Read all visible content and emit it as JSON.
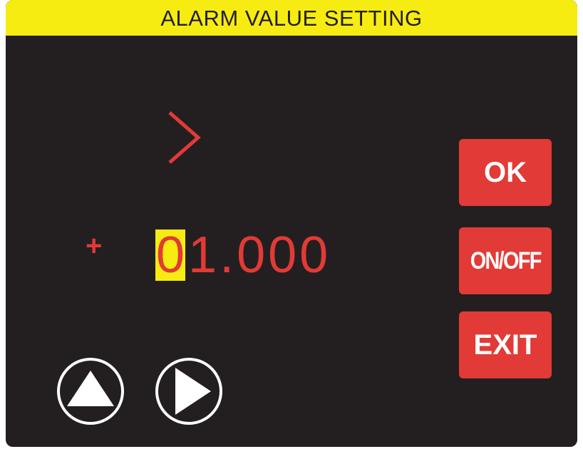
{
  "header": {
    "title": "ALARM VALUE SETTING"
  },
  "setting": {
    "comparator_symbol": ">",
    "sign": "+",
    "value_selected_digit": "0",
    "value_rest": "1.000"
  },
  "buttons": {
    "ok_label": "OK",
    "onoff_label": "ON/OFF",
    "exit_label": "EXIT",
    "up_icon": "triangle-up-icon",
    "right_icon": "triangle-right-icon"
  },
  "colors": {
    "background": "#231f20",
    "title_bar": "#f7ec12",
    "accent_red": "#e23a36",
    "cursor_highlight": "#f7ec12",
    "icon_white": "#ffffff"
  }
}
